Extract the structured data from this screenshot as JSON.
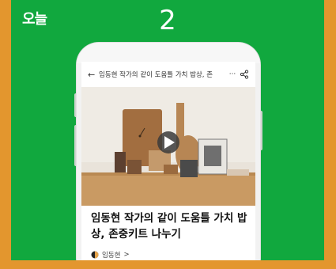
{
  "brand": {
    "logo_text": "오늘"
  },
  "slide": {
    "number": "2"
  },
  "article": {
    "header_title": "임동현 작가의 같이 도움틀 가치 밥상, 존",
    "more_label": "···",
    "headline": "임동현 작가의 같이 도움틀 가치 밥상, 존중키트 나누기",
    "author_name": "임동현",
    "author_chevron": ">"
  },
  "colors": {
    "frame_orange": "#e3962e",
    "panel_green": "#11a83e",
    "play_button": "#3b3b3b"
  },
  "icons": [
    "back-arrow-icon",
    "more-icon",
    "share-icon",
    "play-icon",
    "author-avatar-icon"
  ]
}
